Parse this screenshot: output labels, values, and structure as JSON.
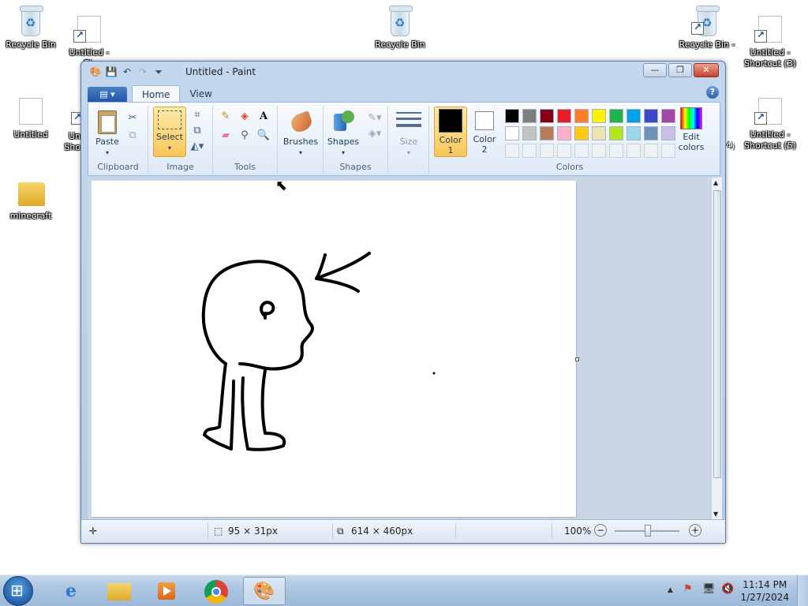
{
  "desktop": {
    "icons": [
      {
        "label": "Recycle Bin"
      },
      {
        "label": "Untitled - Sh"
      },
      {
        "label": "Recycle Bin"
      },
      {
        "label": "Recycle Bin -"
      },
      {
        "label": "Untitled - Shortcut (3)"
      },
      {
        "label": "Untitled"
      },
      {
        "label": "Un Sho"
      },
      {
        "label": "Untitled - Shortcut (5)"
      },
      {
        "label": "minecraft"
      }
    ],
    "partial_label_4": "4)"
  },
  "paint": {
    "title": "Untitled - Paint",
    "tabs": {
      "file": "▤ ▾",
      "home": "Home",
      "view": "View"
    },
    "help": "?",
    "clipboard": {
      "paste": "Paste",
      "group": "Clipboard"
    },
    "image": {
      "select": "Select",
      "group": "Image"
    },
    "tools": {
      "group": "Tools"
    },
    "brushes": {
      "label": "Brushes"
    },
    "shapes": {
      "label": "Shapes",
      "group": "Shapes"
    },
    "size": {
      "label": "Size"
    },
    "color1": {
      "label_top": "Color",
      "label_bottom": "1",
      "value": "#000000"
    },
    "color2": {
      "label_top": "Color",
      "label_bottom": "2",
      "value": "#ffffff"
    },
    "colors_group": "Colors",
    "edit_colors": {
      "line1": "Edit",
      "line2": "colors"
    },
    "palette_row1": [
      "#000000",
      "#7f7f7f",
      "#880015",
      "#ed1c24",
      "#ff7f27",
      "#fff200",
      "#22b14c",
      "#00a2e8",
      "#3f48cc",
      "#a349a4"
    ],
    "palette_row2": [
      "#ffffff",
      "#c3c3c3",
      "#b97a57",
      "#ffaec9",
      "#ffc90e",
      "#efe4b0",
      "#b5e61d",
      "#99d9ea",
      "#7092be",
      "#c8bfe7"
    ],
    "status": {
      "selection_size": "95 × 31px",
      "canvas_size": "614 × 460px",
      "zoom": "100%"
    }
  },
  "taskbar": {
    "time": "11:14 PM",
    "date": "1/27/2024"
  }
}
